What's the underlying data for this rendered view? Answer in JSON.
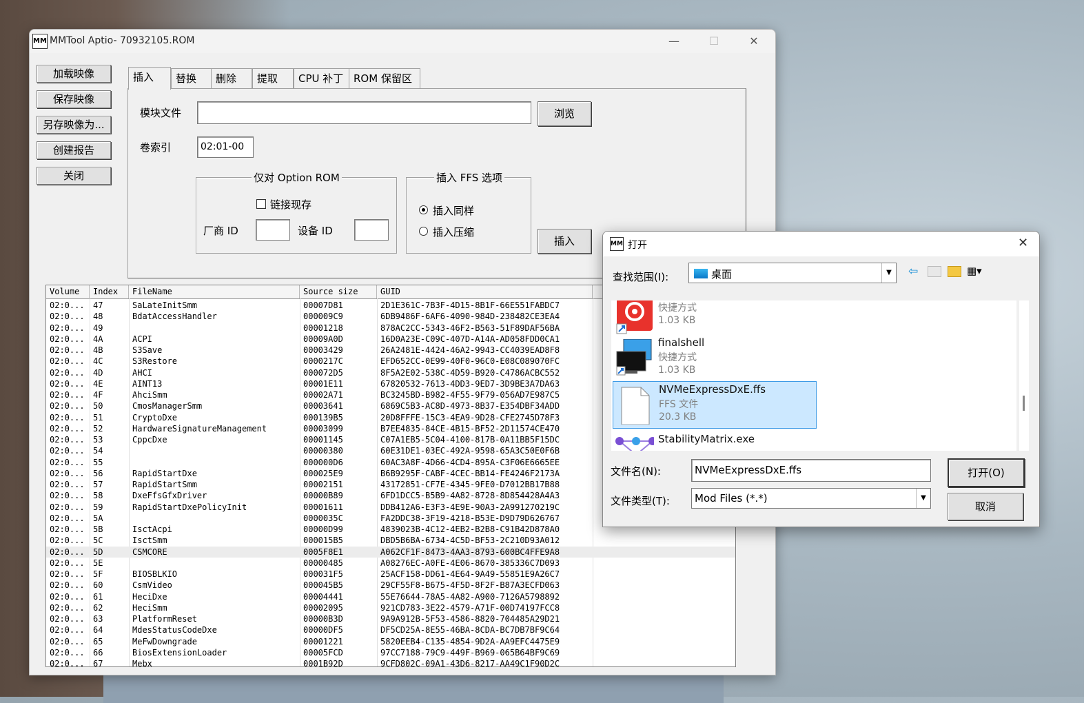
{
  "main": {
    "title": "MMTool Aptio- 70932105.ROM",
    "app_icon": "MM",
    "side_buttons": [
      "加载映像",
      "保存映像",
      "另存映像为...",
      "创建报告",
      "关闭"
    ],
    "tabs": [
      "插入",
      "替换",
      "删除",
      "提取",
      "CPU 补丁",
      "ROM 保留区"
    ],
    "active_tab": "插入",
    "insert": {
      "module_file_label": "模块文件",
      "module_file_value": "",
      "browse_label": "浏览",
      "volume_index_label": "卷索引",
      "volume_index_value": "02:01-00",
      "option_rom_group": "仅对 Option ROM",
      "link_present_label": "链接现存",
      "vendor_id_label": "厂商 ID",
      "device_id_label": "设备 ID",
      "ffs_group": "插入 FFS 选项",
      "insert_as_is_label": "插入同样",
      "insert_compressed_label": "插入压缩",
      "insert_button": "插入"
    },
    "table": {
      "headers": [
        "Volume",
        "Index",
        "FileName",
        "Source size",
        "GUID"
      ],
      "rows": [
        [
          "02:0...",
          "47",
          "SaLateInitSmm",
          "00007D81",
          "2D1E361C-7B3F-4D15-8B1F-66E551FABDC7"
        ],
        [
          "02:0...",
          "48",
          "BdatAccessHandler",
          "000009C9",
          "6DB9486F-6AF6-4090-984D-238482CE3EA4"
        ],
        [
          "02:0...",
          "49",
          "",
          "00001218",
          "878AC2CC-5343-46F2-B563-51F89DAF56BA"
        ],
        [
          "02:0...",
          "4A",
          "ACPI",
          "00009A0D",
          "16D0A23E-C09C-407D-A14A-AD058FDD0CA1"
        ],
        [
          "02:0...",
          "4B",
          "S3Save",
          "00003429",
          "26A2481E-4424-46A2-9943-CC4039EAD8F8"
        ],
        [
          "02:0...",
          "4C",
          "S3Restore",
          "0000217C",
          "EFD652CC-0E99-40F0-96C0-E08C089070FC"
        ],
        [
          "02:0...",
          "4D",
          "AHCI",
          "000072D5",
          "8F5A2E02-538C-4D59-B920-C4786ACBC552"
        ],
        [
          "02:0...",
          "4E",
          "AINT13",
          "00001E11",
          "67820532-7613-4DD3-9ED7-3D9BE3A7DA63"
        ],
        [
          "02:0...",
          "4F",
          "AhciSmm",
          "00002A71",
          "BC3245BD-B982-4F55-9F79-056AD7E987C5"
        ],
        [
          "02:0...",
          "50",
          "CmosManagerSmm",
          "00003641",
          "6869C5B3-AC8D-4973-8B37-E354DBF34ADD"
        ],
        [
          "02:0...",
          "51",
          "CryptoDxe",
          "000139B5",
          "20D8FFFE-15C3-4EA9-9D28-CFE2745D78F3"
        ],
        [
          "02:0...",
          "52",
          "HardwareSignatureManagement",
          "00003099",
          "B7EE4835-84CE-4B15-BF52-2D11574CE470"
        ],
        [
          "02:0...",
          "53",
          "CppcDxe",
          "00001145",
          "C07A1EB5-5C04-4100-817B-0A11BB5F15DC"
        ],
        [
          "02:0...",
          "54",
          "",
          "00000380",
          "60E31DE1-03EC-492A-9598-65A3C50E0F6B"
        ],
        [
          "02:0...",
          "55",
          "",
          "000000D6",
          "60AC3A8F-4D66-4CD4-895A-C3F06E6665EE"
        ],
        [
          "02:0...",
          "56",
          "RapidStartDxe",
          "000025E9",
          "B6B9295F-CABF-4CEC-BB14-FE4246F2173A"
        ],
        [
          "02:0...",
          "57",
          "RapidStartSmm",
          "00002151",
          "43172851-CF7E-4345-9FE0-D7012BB17B88"
        ],
        [
          "02:0...",
          "58",
          "DxeFfsGfxDriver",
          "00000B89",
          "6FD1DCC5-B5B9-4A82-8728-8D854428A4A3"
        ],
        [
          "02:0...",
          "59",
          "RapidStartDxePolicyInit",
          "00001611",
          "DDB412A6-E3F3-4E9E-90A3-2A991270219C"
        ],
        [
          "02:0...",
          "5A",
          "",
          "0000035C",
          "FA2DDC38-3F19-4218-B53E-D9D79D626767"
        ],
        [
          "02:0...",
          "5B",
          "IsctAcpi",
          "00000D99",
          "4839023B-4C12-4EB2-B2B8-C91B42D878A0"
        ],
        [
          "02:0...",
          "5C",
          "IsctSmm",
          "000015B5",
          "DBD5B6BA-6734-4C5D-BF53-2C210D93A012"
        ],
        [
          "02:0...",
          "5D",
          "CSMCORE",
          "0005F8E1",
          "A062CF1F-8473-4AA3-8793-600BC4FFE9A8"
        ],
        [
          "02:0...",
          "5E",
          "",
          "00000485",
          "A08276EC-A0FE-4E06-8670-385336C7D093"
        ],
        [
          "02:0...",
          "5F",
          "BIOSBLKIO",
          "000031F5",
          "25ACF158-DD61-4E64-9A49-55851E9A26C7"
        ],
        [
          "02:0...",
          "60",
          "CsmVideo",
          "000045B5",
          "29CF55F8-B675-4F5D-8F2F-B87A3ECFD063"
        ],
        [
          "02:0...",
          "61",
          "HeciDxe",
          "00004441",
          "55E76644-78A5-4A82-A900-7126A5798892"
        ],
        [
          "02:0...",
          "62",
          "HeciSmm",
          "00002095",
          "921CD783-3E22-4579-A71F-00D74197FCC8"
        ],
        [
          "02:0...",
          "63",
          "PlatformReset",
          "00000B3D",
          "9A9A912B-5F53-4586-8820-704485A29D21"
        ],
        [
          "02:0...",
          "64",
          "MdesStatusCodeDxe",
          "00000DF5",
          "DF5CD25A-8E55-46BA-8CDA-BC7DB7BF9C64"
        ],
        [
          "02:0...",
          "65",
          "MeFwDowngrade",
          "00001221",
          "5820EEB4-C135-4854-9D2A-AA9EFC4475E9"
        ],
        [
          "02:0...",
          "66",
          "BiosExtensionLoader",
          "00005FCD",
          "97CC7188-79C9-449F-B969-065B64BF9C69"
        ],
        [
          "02:0...",
          "67",
          "Mebx",
          "0001B92D",
          "9CFD802C-09A1-43D6-8217-AA49C1F90D2C"
        ]
      ],
      "selected_index": "5D"
    }
  },
  "dialog": {
    "title": "打开",
    "look_in_label": "查找范围(I):",
    "look_in_value": "桌面",
    "files": [
      {
        "name": "",
        "type": "快捷方式",
        "size": "1.03 KB",
        "icon": "red-app-shortcut-icon"
      },
      {
        "name": "finalshell",
        "type": "快捷方式",
        "size": "1.03 KB",
        "icon": "monitor-shortcut-icon"
      },
      {
        "name": "NVMeExpressDxE.ffs",
        "type": "FFS 文件",
        "size": "20.3 KB",
        "icon": "file-icon"
      },
      {
        "name": "StabilityMatrix.exe",
        "type": "",
        "size": "",
        "icon": "molecule-app-icon"
      }
    ],
    "filename_label": "文件名(N):",
    "filename_value": "NVMeExpressDxE.ffs",
    "filetype_label": "文件类型(T):",
    "filetype_value": "Mod Files (*.*)",
    "open_button": "打开(O)",
    "cancel_button": "取消"
  }
}
